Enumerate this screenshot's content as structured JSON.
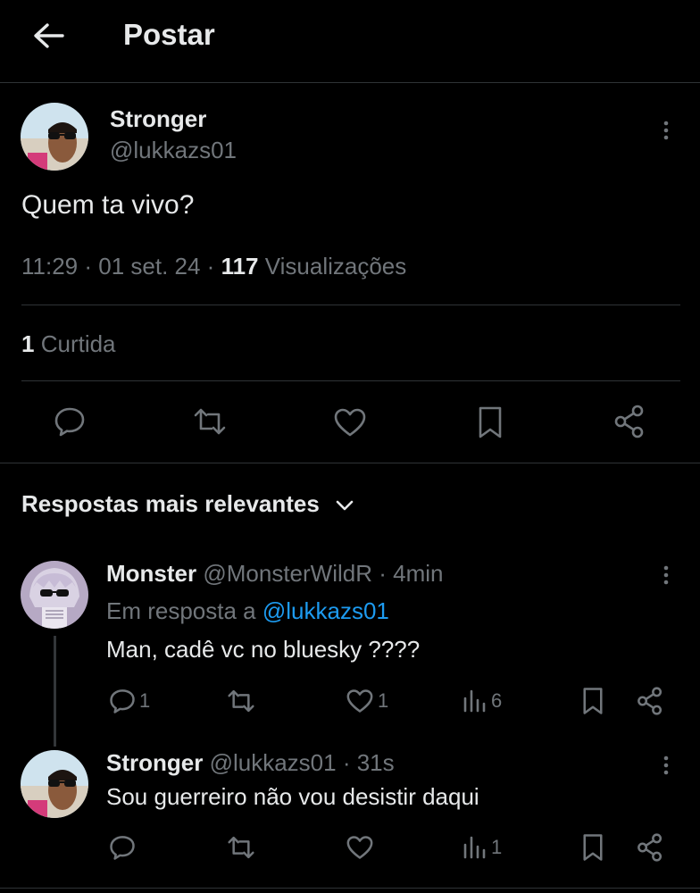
{
  "header": {
    "title": "Postar"
  },
  "post": {
    "name": "Stronger",
    "handle": "@lukkazs01",
    "text": "Quem ta vivo?",
    "time": "11:29",
    "date": "01 set. 24",
    "views_count": "117",
    "views_label": "Visualizações",
    "likes_count": "1",
    "likes_label": "Curtida"
  },
  "replies_sort": {
    "label": "Respostas mais relevantes"
  },
  "replies": [
    {
      "name": "Monster",
      "handle": "@MonsterWildR",
      "time": "4min",
      "reply_to_label": "Em resposta a",
      "reply_to_handle": "@lukkazs01",
      "text": "Man, cadê vc no bluesky ????",
      "reply_count": "1",
      "like_count": "1",
      "view_count": "6"
    },
    {
      "name": "Stronger",
      "handle": "@lukkazs01",
      "time": "31s",
      "text": "Sou guerreiro não vou desistir daqui",
      "view_count": "1"
    }
  ],
  "icons": {
    "back": "arrow-left-icon",
    "more": "more-vertical-icon",
    "reply": "reply-icon",
    "repost": "repost-icon",
    "like": "heart-icon",
    "bookmark": "bookmark-icon",
    "share": "share-icon",
    "views": "views-icon",
    "chevron": "chevron-down-icon"
  },
  "colors": {
    "background": "#000000",
    "text": "#e7e9ea",
    "muted": "#71767b",
    "link": "#1d9bf0",
    "divider": "#2f3336"
  }
}
